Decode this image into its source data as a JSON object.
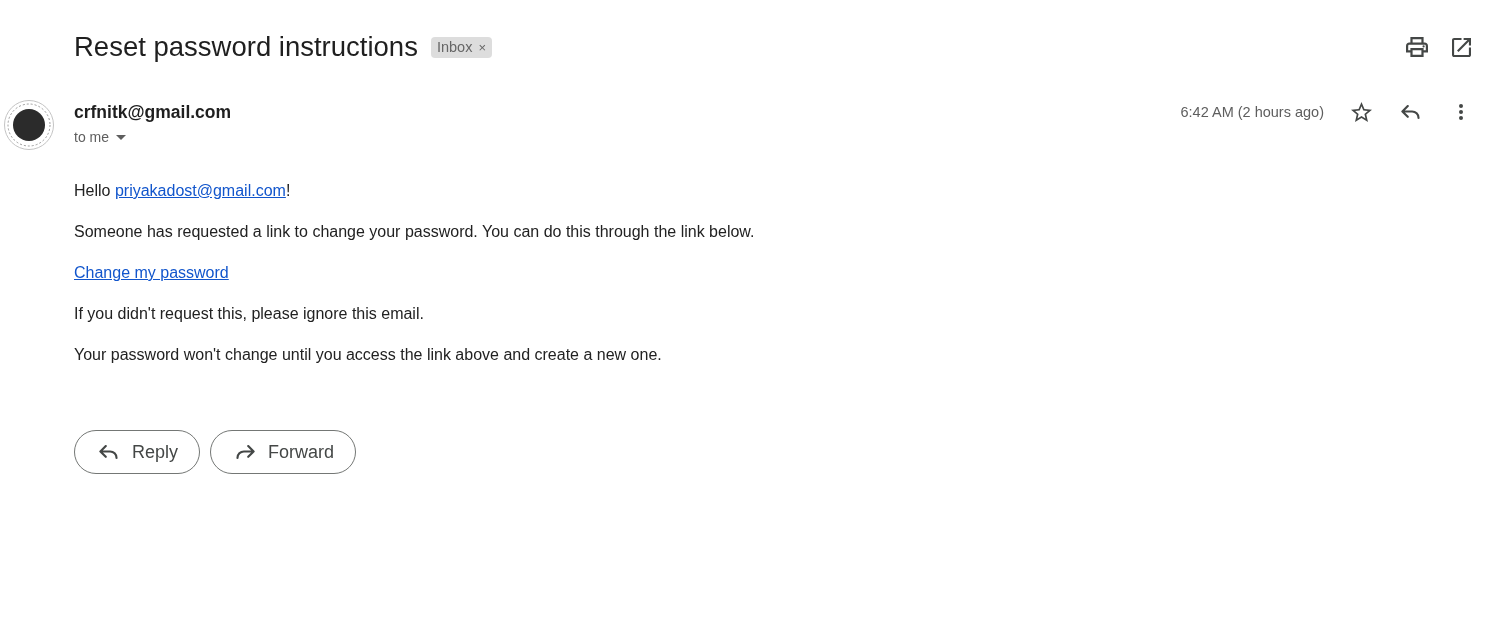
{
  "subject": {
    "title": "Reset password instructions",
    "labels": [
      {
        "text": "Inbox",
        "remove": "×"
      }
    ]
  },
  "message": {
    "sender": "crfnitk@gmail.com",
    "recipient": "to me",
    "time": "6:42 AM (2 hours ago)",
    "starred": false,
    "body": [
      {
        "segments": [
          {
            "kind": "text",
            "text": "Hello "
          },
          {
            "kind": "link",
            "text": "priyakadost@gmail.com"
          },
          {
            "kind": "text",
            "text": "!"
          }
        ]
      },
      {
        "segments": [
          {
            "kind": "text",
            "text": "Someone has requested a link to change your password. You can do this through the link below."
          }
        ]
      },
      {
        "segments": [
          {
            "kind": "link",
            "text": "Change my password"
          }
        ]
      },
      {
        "segments": [
          {
            "kind": "text",
            "text": "If you didn't request this, please ignore this email."
          }
        ]
      },
      {
        "segments": [
          {
            "kind": "text",
            "text": "Your password won't change until you access the link above and create a new one."
          }
        ]
      }
    ]
  },
  "actions": [
    {
      "kind": "reply",
      "label": "Reply"
    },
    {
      "kind": "forward",
      "label": "Forward"
    }
  ]
}
